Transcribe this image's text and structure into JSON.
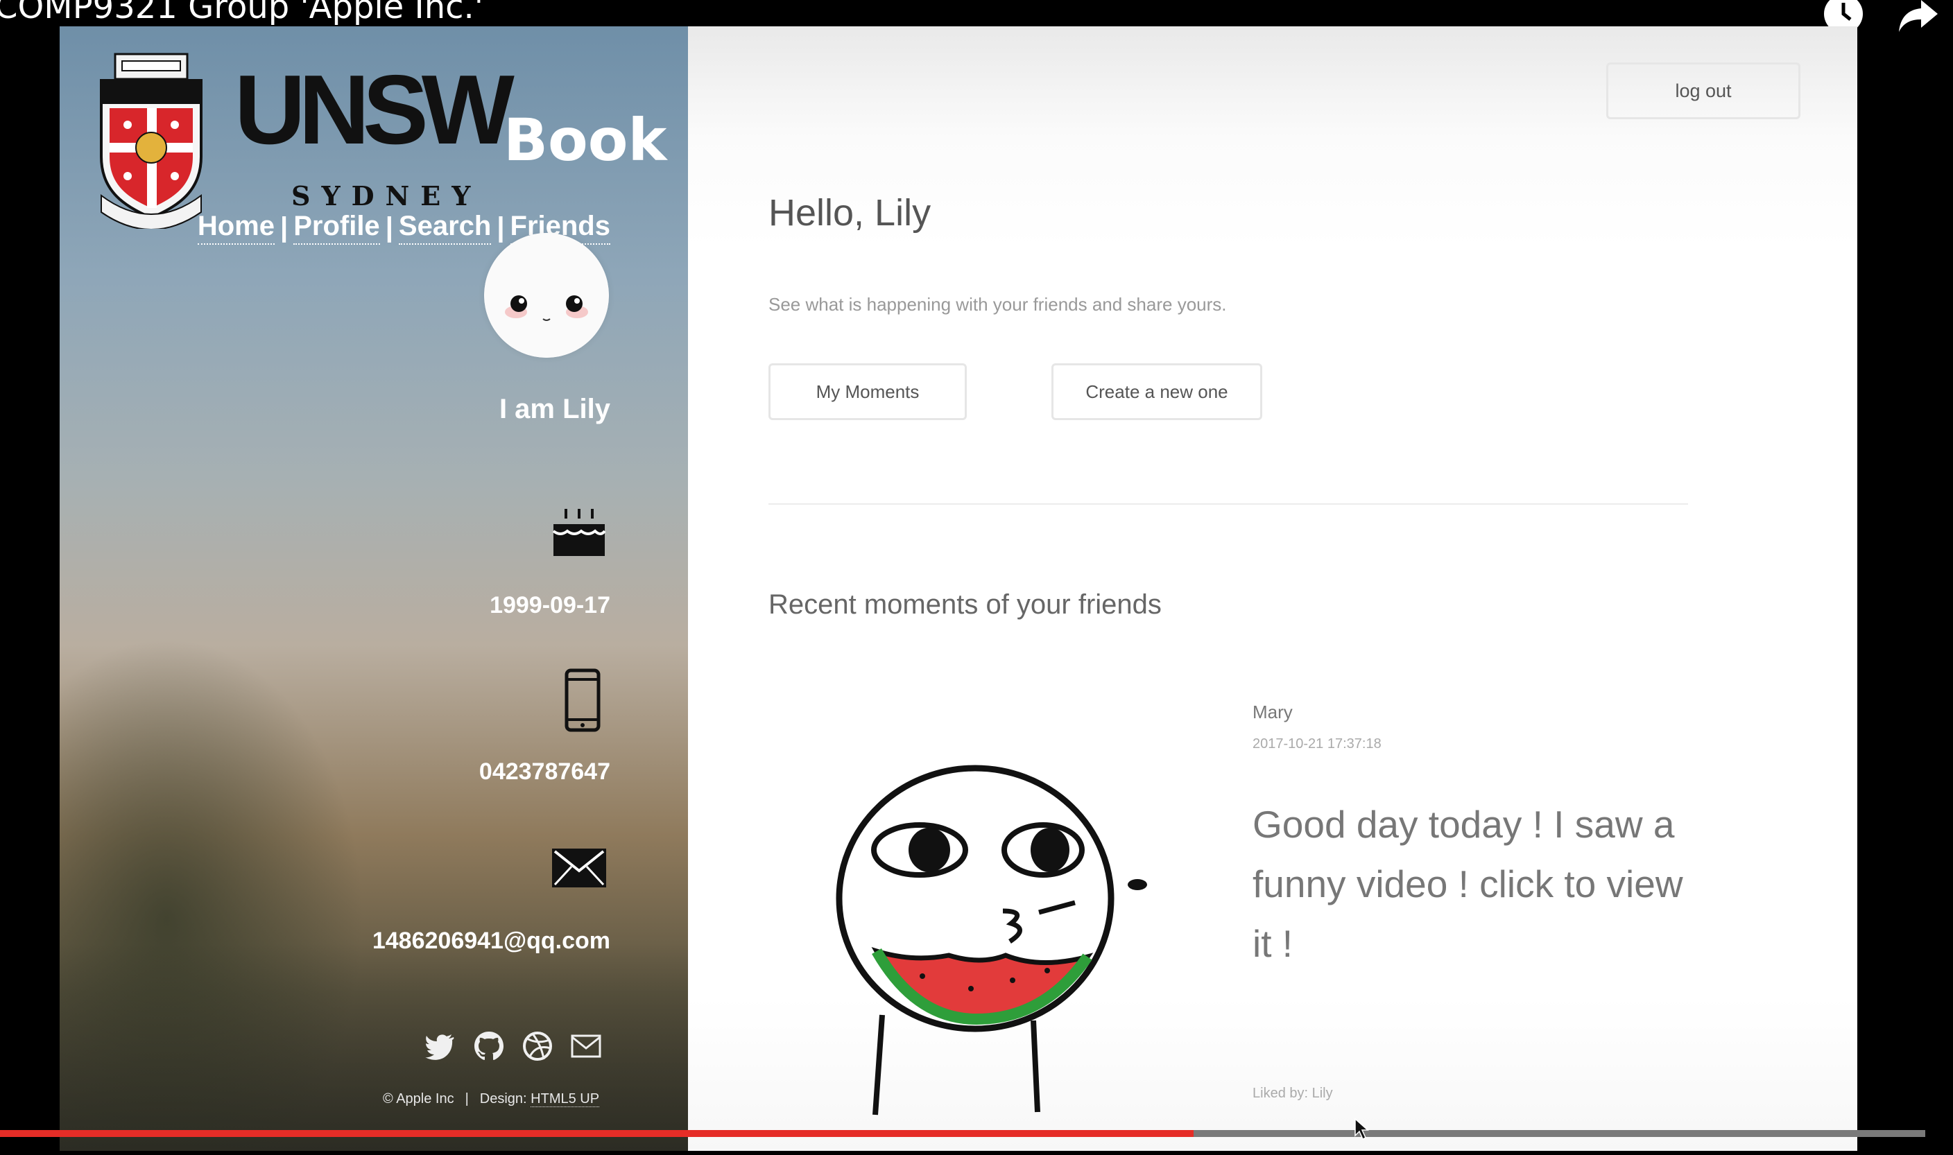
{
  "video": {
    "title": "COMP9321 Group 'Apple Inc.'",
    "progress": 0.62
  },
  "brand": {
    "name": "UNSW",
    "product": "Book",
    "city": "SYDNEY"
  },
  "nav": [
    "Home",
    "Profile",
    "Search",
    "Friends"
  ],
  "profile": {
    "greeting": "I am Lily",
    "birthday": "1999-09-17",
    "phone": "0423787647",
    "email": "1486206941@qq.com"
  },
  "social_icons": [
    "twitter-icon",
    "github-icon",
    "dribbble-icon",
    "mail-icon"
  ],
  "footer": {
    "copyright": "© Apple Inc",
    "design_label": "Design:",
    "design_link": "HTML5 UP"
  },
  "main": {
    "logout_label": "log out",
    "hello": "Hello, Lily",
    "subtitle": "See what is happening with your friends and share yours.",
    "btn_my_moments": "My Moments",
    "btn_create": "Create a new one",
    "section_title": "Recent moments of your friends"
  },
  "moment": {
    "author": "Mary",
    "time": "2017-10-21 17:37:18",
    "text": "Good day today ! I saw a funny video ! click to view it !",
    "liked_by": "Liked by: Lily"
  },
  "colors": {
    "accent": "#e52d27",
    "text": "#555555"
  }
}
